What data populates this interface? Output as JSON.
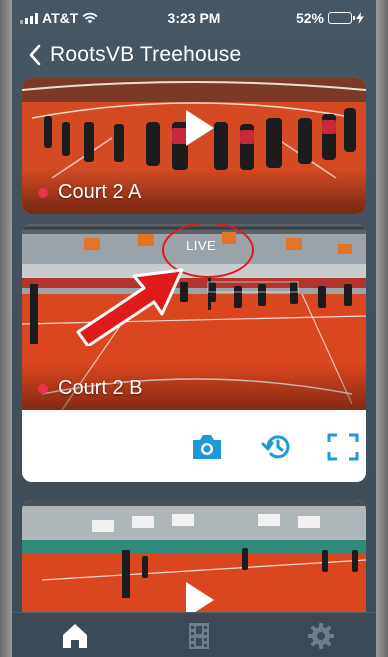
{
  "status_bar": {
    "carrier": "AT&T",
    "time": "3:23 PM",
    "battery": "52%",
    "battery_level": 0.52
  },
  "nav": {
    "title": "RootsVB Treehouse",
    "back_icon": "chevron-left-icon"
  },
  "courts": [
    {
      "label": "Court 2 A",
      "status_color": "#e8344a",
      "state": "playback"
    },
    {
      "label": "Court 2 B",
      "status_color": "#e8344a",
      "state": "live",
      "live_text": "LIVE"
    },
    {
      "label": "",
      "state": "playback"
    }
  ],
  "controls": [
    {
      "name": "camera-icon"
    },
    {
      "name": "history-icon"
    },
    {
      "name": "fullscreen-icon"
    }
  ],
  "tabs": [
    {
      "name": "home-icon",
      "active": true
    },
    {
      "name": "film-icon",
      "active": false
    },
    {
      "name": "gear-icon",
      "active": false
    }
  ],
  "colors": {
    "accent": "#1c9ad6",
    "background": "#465663",
    "court_floor": "#d9461f",
    "live_indicator": "#e8344a",
    "annotation": "#e01a1a"
  }
}
